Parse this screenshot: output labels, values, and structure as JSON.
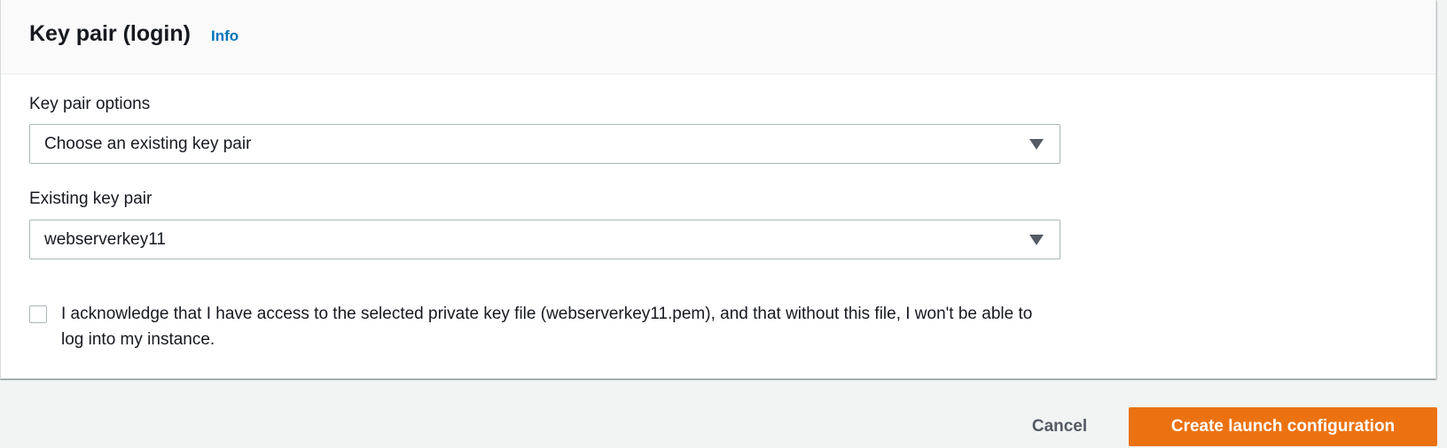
{
  "panel": {
    "title": "Key pair (login)",
    "info_link": "Info"
  },
  "key_pair_options": {
    "label": "Key pair options",
    "selected": "Choose an existing key pair"
  },
  "existing_key_pair": {
    "label": "Existing key pair",
    "selected": "webserverkey11"
  },
  "acknowledgement": {
    "checked": false,
    "text": "I acknowledge that I have access to the selected private key file (webserverkey11.pem), and that without this file, I won't be able to log into my instance."
  },
  "footer": {
    "cancel_label": "Cancel",
    "submit_label": "Create launch configuration"
  },
  "colors": {
    "primary_button": "#ec7211",
    "info_link": "#0073bb",
    "page_background": "#f2f3f3",
    "header_background": "#fafafa"
  },
  "icons": {
    "dropdown": "caret-down-icon",
    "checkbox": "checkbox-icon"
  }
}
